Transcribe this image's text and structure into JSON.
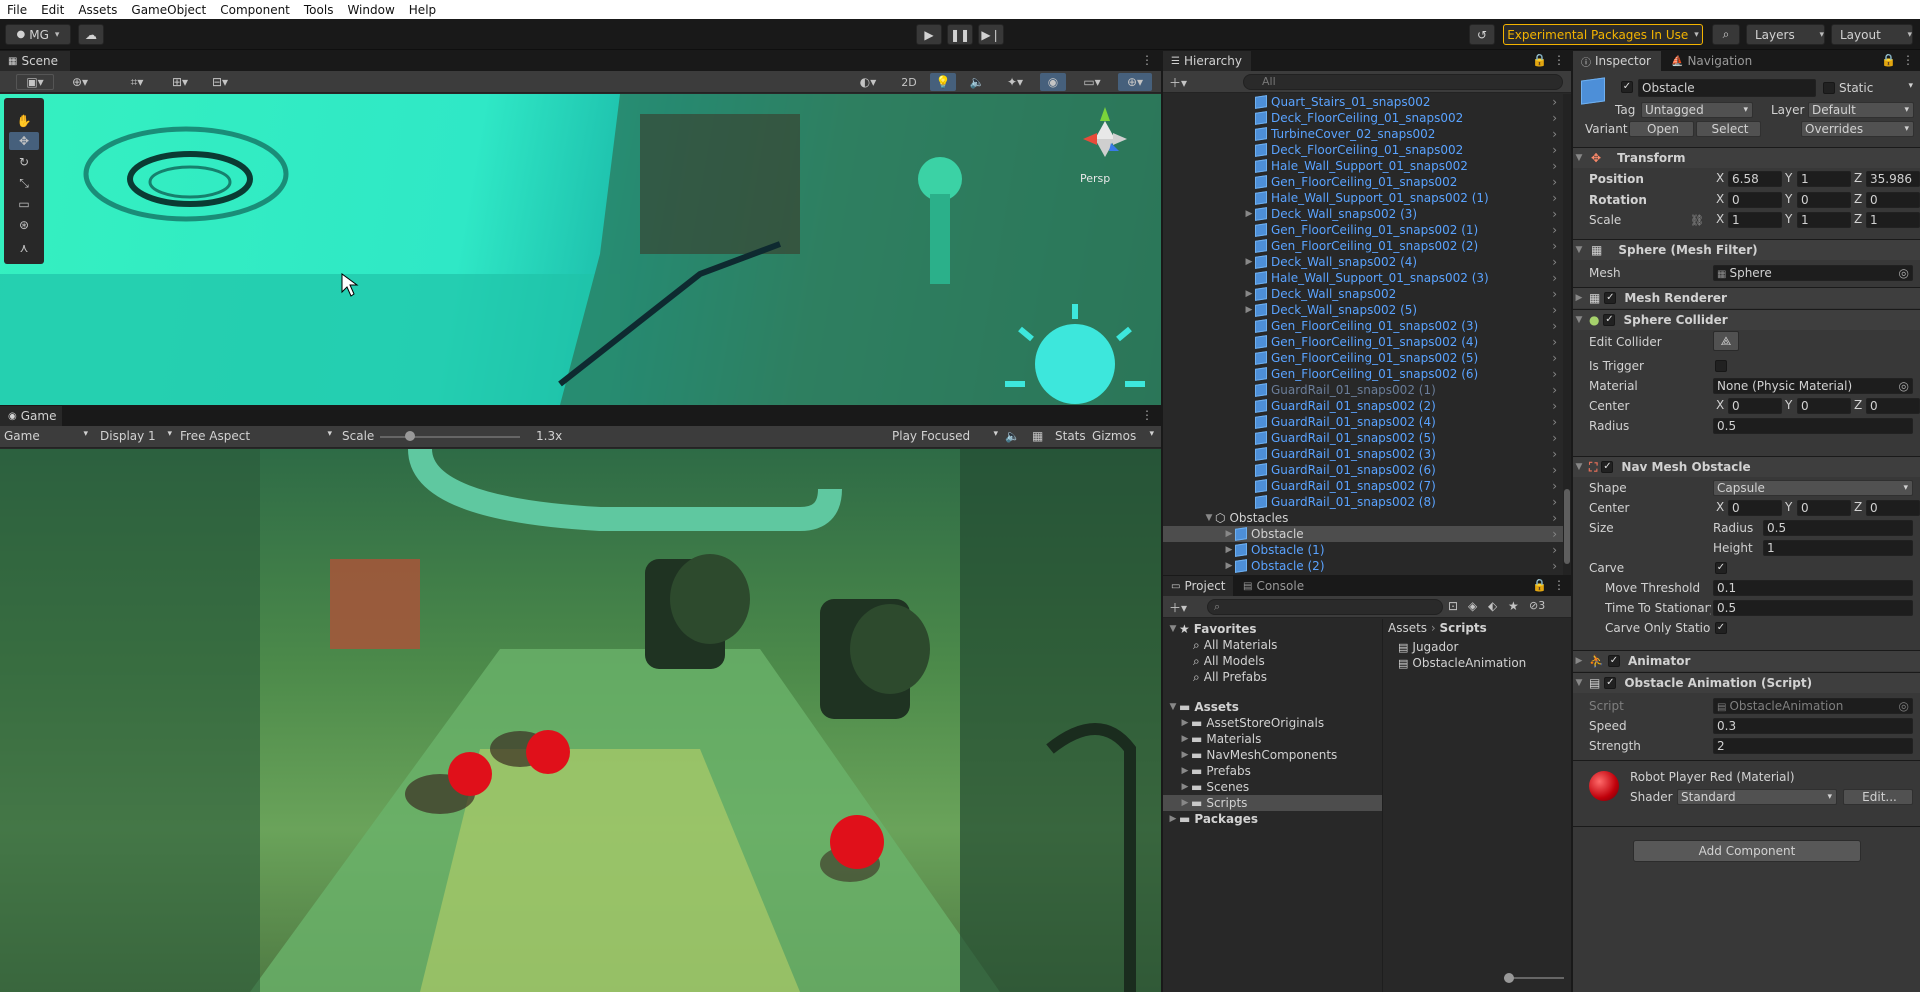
{
  "menubar": [
    "File",
    "Edit",
    "Assets",
    "GameObject",
    "Component",
    "Tools",
    "Window",
    "Help"
  ],
  "toolbar": {
    "account": "MG",
    "warning": "Experimental Packages In Use",
    "layers": "Layers",
    "layout": "Layout"
  },
  "scene": {
    "tab": "Scene",
    "mode_2d": "2D",
    "persp": "Persp"
  },
  "game": {
    "tab": "Game",
    "view": "Game",
    "display": "Display 1",
    "aspect": "Free Aspect",
    "scale_label": "Scale",
    "scale_value": "1.3x",
    "play_focused": "Play Focused",
    "stats": "Stats",
    "gizmos": "Gizmos"
  },
  "hierarchy": {
    "tab": "Hierarchy",
    "search": "All",
    "items": [
      {
        "name": "Quart_Stairs_01_snaps002",
        "indent": 0,
        "arrow": false,
        "style": "blue"
      },
      {
        "name": "Deck_FloorCeiling_01_snaps002",
        "indent": 0,
        "arrow": false,
        "style": "blue"
      },
      {
        "name": "TurbineCover_02_snaps002",
        "indent": 0,
        "arrow": false,
        "style": "blue"
      },
      {
        "name": "Deck_FloorCeiling_01_snaps002",
        "indent": 0,
        "arrow": false,
        "style": "blue"
      },
      {
        "name": "Hale_Wall_Support_01_snaps002",
        "indent": 0,
        "arrow": false,
        "style": "blue"
      },
      {
        "name": "Gen_FloorCeiling_01_snaps002",
        "indent": 0,
        "arrow": false,
        "style": "blue"
      },
      {
        "name": "Hale_Wall_Support_01_snaps002 (1)",
        "indent": 0,
        "arrow": false,
        "style": "blue"
      },
      {
        "name": "Deck_Wall_snaps002 (3)",
        "indent": 0,
        "arrow": true,
        "style": "blue"
      },
      {
        "name": "Gen_FloorCeiling_01_snaps002 (1)",
        "indent": 0,
        "arrow": false,
        "style": "blue"
      },
      {
        "name": "Gen_FloorCeiling_01_snaps002 (2)",
        "indent": 0,
        "arrow": false,
        "style": "blue"
      },
      {
        "name": "Deck_Wall_snaps002 (4)",
        "indent": 0,
        "arrow": true,
        "style": "blue"
      },
      {
        "name": "Hale_Wall_Support_01_snaps002 (3)",
        "indent": 0,
        "arrow": false,
        "style": "blue"
      },
      {
        "name": "Deck_Wall_snaps002",
        "indent": 0,
        "arrow": true,
        "style": "blue"
      },
      {
        "name": "Deck_Wall_snaps002 (5)",
        "indent": 0,
        "arrow": true,
        "style": "blue"
      },
      {
        "name": "Gen_FloorCeiling_01_snaps002 (3)",
        "indent": 0,
        "arrow": false,
        "style": "blue"
      },
      {
        "name": "Gen_FloorCeiling_01_snaps002 (4)",
        "indent": 0,
        "arrow": false,
        "style": "blue"
      },
      {
        "name": "Gen_FloorCeiling_01_snaps002 (5)",
        "indent": 0,
        "arrow": false,
        "style": "blue"
      },
      {
        "name": "Gen_FloorCeiling_01_snaps002 (6)",
        "indent": 0,
        "arrow": false,
        "style": "blue"
      },
      {
        "name": "GuardRail_01_snaps002 (1)",
        "indent": 0,
        "arrow": false,
        "style": "dim"
      },
      {
        "name": "GuardRail_01_snaps002 (2)",
        "indent": 0,
        "arrow": false,
        "style": "blue"
      },
      {
        "name": "GuardRail_01_snaps002 (4)",
        "indent": 0,
        "arrow": false,
        "style": "blue"
      },
      {
        "name": "GuardRail_01_snaps002 (5)",
        "indent": 0,
        "arrow": false,
        "style": "blue"
      },
      {
        "name": "GuardRail_01_snaps002 (3)",
        "indent": 0,
        "arrow": false,
        "style": "blue"
      },
      {
        "name": "GuardRail_01_snaps002 (6)",
        "indent": 0,
        "arrow": false,
        "style": "blue"
      },
      {
        "name": "GuardRail_01_snaps002 (7)",
        "indent": 0,
        "arrow": false,
        "style": "blue"
      },
      {
        "name": "GuardRail_01_snaps002 (8)",
        "indent": 0,
        "arrow": false,
        "style": "blue"
      },
      {
        "name": "Obstacles",
        "indent": -1,
        "arrow": true,
        "style": "white"
      },
      {
        "name": "Obstacle",
        "indent": 1,
        "arrow": true,
        "style": "white"
      },
      {
        "name": "Obstacle (1)",
        "indent": 1,
        "arrow": true,
        "style": "blue"
      },
      {
        "name": "Obstacle (2)",
        "indent": 1,
        "arrow": true,
        "style": "blue"
      }
    ]
  },
  "project": {
    "tab_project": "Project",
    "tab_console": "Console",
    "hidden_count": "3",
    "favorites": {
      "label": "Favorites",
      "items": [
        "All Materials",
        "All Models",
        "All Prefabs"
      ]
    },
    "assets": {
      "label": "Assets",
      "items": [
        "AssetStoreOriginals",
        "Materials",
        "NavMeshComponents",
        "Prefabs",
        "Scenes",
        "Scripts"
      ]
    },
    "packages": "Packages",
    "breadcrumb": [
      "Assets",
      "Scripts"
    ],
    "files": [
      "Jugador",
      "ObstacleAnimation"
    ]
  },
  "inspector": {
    "tab": "Inspector",
    "tab_nav": "Navigation",
    "name": "Obstacle",
    "static": "Static",
    "tag_label": "Tag",
    "tag": "Untagged",
    "layer_label": "Layer",
    "layer": "Default",
    "variant_label": "Variant",
    "open": "Open",
    "select": "Select",
    "overrides": "Overrides",
    "transform": {
      "title": "Transform",
      "position": "Position",
      "rotation": "Rotation",
      "scale": "Scale",
      "pos": [
        "6.58",
        "1",
        "35.986"
      ],
      "rot": [
        "0",
        "0",
        "0"
      ],
      "scl": [
        "1",
        "1",
        "1"
      ]
    },
    "meshfilter": {
      "title": "Sphere (Mesh Filter)",
      "mesh_label": "Mesh",
      "mesh": "Sphere"
    },
    "meshrenderer": {
      "title": "Mesh Renderer"
    },
    "collider": {
      "title": "Sphere Collider",
      "edit": "Edit Collider",
      "trigger": "Is Trigger",
      "material_label": "Material",
      "material": "None (Physic Material)",
      "center_label": "Center",
      "center": [
        "0",
        "0",
        "0"
      ],
      "radius_label": "Radius",
      "radius": "0.5"
    },
    "navobs": {
      "title": "Nav Mesh Obstacle",
      "shape_label": "Shape",
      "shape": "Capsule",
      "center_label": "Center",
      "center": [
        "0",
        "0",
        "0"
      ],
      "size_label": "Size",
      "radius_label": "Radius",
      "radius": "0.5",
      "height_label": "Height",
      "height": "1",
      "carve": "Carve",
      "move_thr": "Move Threshold",
      "move_thr_v": "0.1",
      "time_stat": "Time To Stationary",
      "time_stat_v": "0.5",
      "carve_only": "Carve Only Station"
    },
    "animator": {
      "title": "Animator"
    },
    "script": {
      "title": "Obstacle Animation (Script)",
      "script_label": "Script",
      "script": "ObstacleAnimation",
      "speed_label": "Speed",
      "speed": "0.3",
      "strength_label": "Strength",
      "strength": "2"
    },
    "material": {
      "title": "Robot Player Red (Material)",
      "shader_label": "Shader",
      "shader": "Standard",
      "edit": "Edit..."
    },
    "add_component": "Add Component"
  },
  "axis": {
    "x": "X",
    "y": "Y",
    "z": "Z"
  },
  "colors": {
    "accent": "#3a79bb",
    "warning": "#f4b400",
    "blue_text": "#5aa3ff"
  }
}
